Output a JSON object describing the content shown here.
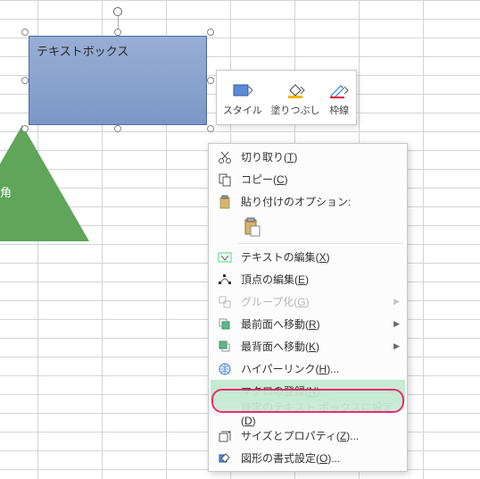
{
  "shape": {
    "text": "テキストボックス"
  },
  "triangle": {
    "label": "角"
  },
  "miniToolbar": {
    "style": "スタイル",
    "fill": "塗りつぶし",
    "outline": "枠線"
  },
  "menu": {
    "cut": "切り取り(T)",
    "copy": "コピー(C)",
    "pasteOptions": "貼り付けのオプション:",
    "editText": "テキストの編集(X)",
    "editPoints": "頂点の編集(E)",
    "group": "グループ化(G)",
    "bringFront": "最前面へ移動(R)",
    "sendBack": "最背面へ移動(K)",
    "hyperlink": "ハイパーリンク(H)...",
    "assignMacro": "マクロの登録(N)...",
    "setDefault": "既定のテキスト ボックスに設定(D)",
    "sizeProps": "サイズとプロパティ(Z)...",
    "formatShape": "図形の書式設定(O)..."
  }
}
